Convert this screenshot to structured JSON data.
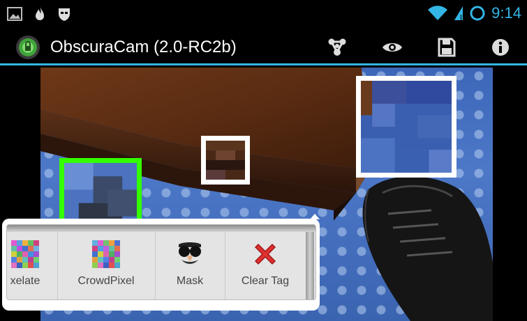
{
  "status_bar": {
    "time": "9:14",
    "left_icons": [
      "gallery-icon",
      "flame-icon",
      "mask-notification-icon"
    ],
    "right_icons": [
      "wifi-icon",
      "signal-icon",
      "sync-ring-icon"
    ],
    "accent": "#33b5e5"
  },
  "action_bar": {
    "title": "ObscuraCam (2.0-RC2b)",
    "actions": [
      "share-icon",
      "preview-eye-icon",
      "save-icon",
      "info-icon"
    ],
    "accent": "#33b5e5"
  },
  "image": {
    "tags": [
      {
        "style": "white",
        "selected": false,
        "region": "cabinet-top-right"
      },
      {
        "style": "white",
        "selected": false,
        "region": "cabinet-edge"
      },
      {
        "style": "green",
        "selected": true,
        "region": "floor-left"
      }
    ],
    "selected_color": "#33ff00",
    "unselected_color": "#ffffff"
  },
  "popup": {
    "tools": [
      {
        "label": "xelate",
        "icon": "pixelate-icon"
      },
      {
        "label": "CrowdPixel",
        "icon": "crowdpixel-icon"
      },
      {
        "label": "Mask",
        "icon": "mask-icon"
      },
      {
        "label": "Clear Tag",
        "icon": "clear-tag-icon"
      }
    ]
  }
}
